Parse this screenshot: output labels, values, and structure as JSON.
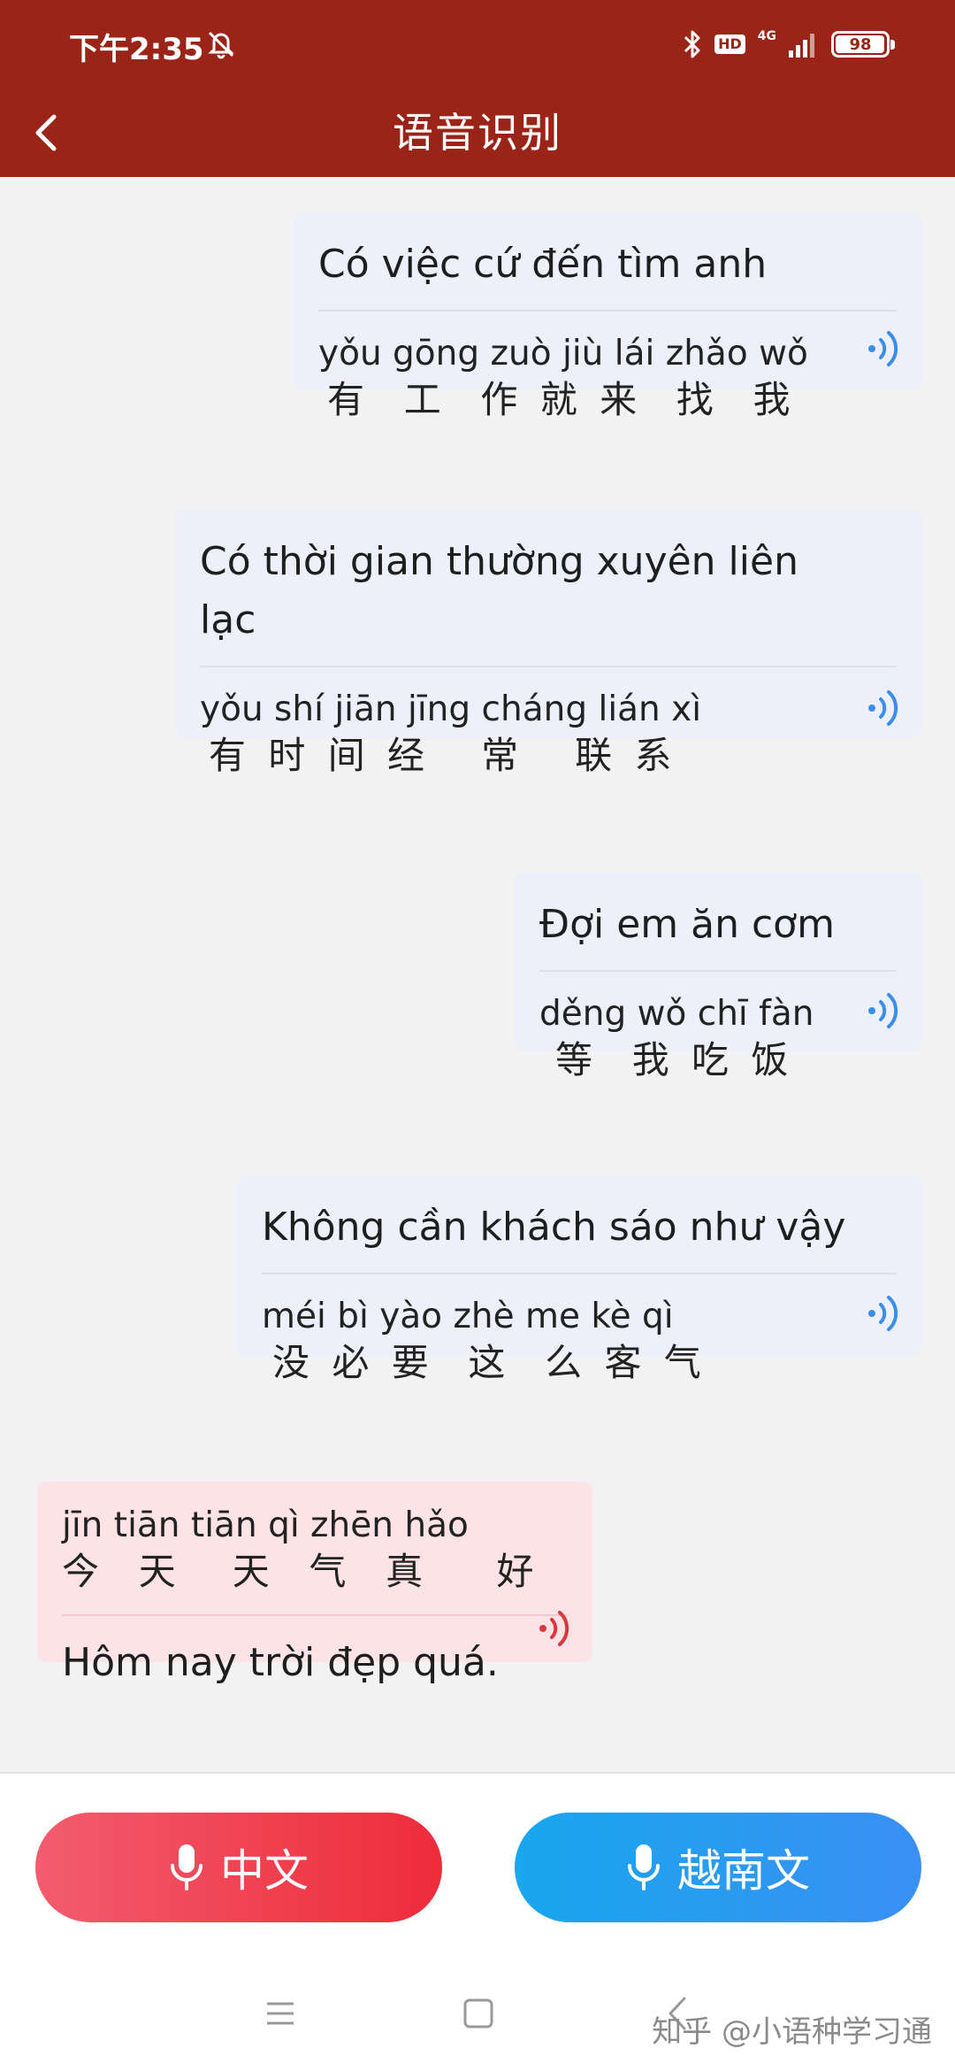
{
  "status_bar": {
    "time": "下午2:35",
    "hd": "HD",
    "network": "4G",
    "battery": "98",
    "battery_level": 0.98
  },
  "header": {
    "title": "语音识别"
  },
  "messages": [
    {
      "side": "right",
      "vietnamese": "Có việc cứ đến tìm anh",
      "pinyin": "yǒu gōng zuò jiù lái zhǎo wǒ",
      "hanzi": "有  工  作 就 来  找  我"
    },
    {
      "side": "right",
      "vietnamese": "Có thời gian thường xuyên liên lạc",
      "pinyin": "yǒu shí jiān jīng cháng lián  xì",
      "hanzi": "有 时 间 经   常   联 系"
    },
    {
      "side": "right",
      "vietnamese": "Đợi em ăn cơm",
      "pinyin": "děng wǒ chī fàn",
      "hanzi": "等  我 吃 饭"
    },
    {
      "side": "right",
      "vietnamese": "Không cần khách sáo như vậy",
      "pinyin": "méi  bì  yào zhè me kè  qì",
      "hanzi": "没 必 要  这  么 客 气"
    },
    {
      "side": "left",
      "pinyin": "jīn tiān tiān  qì  zhēn  hǎo",
      "hanzi": "今  天   天  气  真    好",
      "vietnamese": "Hôm nay trời đẹp quá."
    }
  ],
  "buttons": {
    "chinese": "中文",
    "vietnamese": "越南文"
  },
  "watermark": "知乎 @小语种学习通",
  "colors": {
    "header": "#9b2418",
    "bubble_blue": "#edf0fb",
    "bubble_pink": "#fde3e5",
    "speaker_blue": "#3a8ee6",
    "speaker_red": "#d8373f"
  },
  "icons": [
    "back-chevron-icon",
    "mute-icon",
    "bluetooth-icon",
    "signal-icon",
    "battery-icon",
    "speaker-icon",
    "microphone-icon",
    "menu-icon",
    "home-square-icon",
    "back-nav-icon"
  ]
}
